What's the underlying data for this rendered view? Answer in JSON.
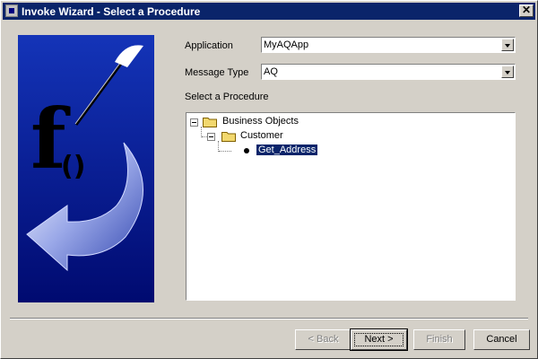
{
  "window": {
    "title": "Invoke Wizard - Select a Procedure",
    "close_glyph": "✕"
  },
  "art": {
    "glyph_f": "f",
    "glyph_parens": "()"
  },
  "form": {
    "application": {
      "label": "Application",
      "value": "MyAQApp"
    },
    "message_type": {
      "label": "Message Type",
      "value": "AQ"
    },
    "procedure_label": "Select a Procedure"
  },
  "tree": {
    "nodes": [
      {
        "label": "Business Objects",
        "level": 0,
        "expanded": true
      },
      {
        "label": "Customer",
        "level": 1,
        "expanded": true
      },
      {
        "label": "Get_Address",
        "level": 2,
        "selected": true
      }
    ]
  },
  "buttons": {
    "back": "< Back",
    "next": "Next >",
    "finish": "Finish",
    "cancel": "Cancel"
  },
  "colors": {
    "title_bar": "#0a246a",
    "face": "#d4d0c8",
    "selection": "#0a246a"
  }
}
